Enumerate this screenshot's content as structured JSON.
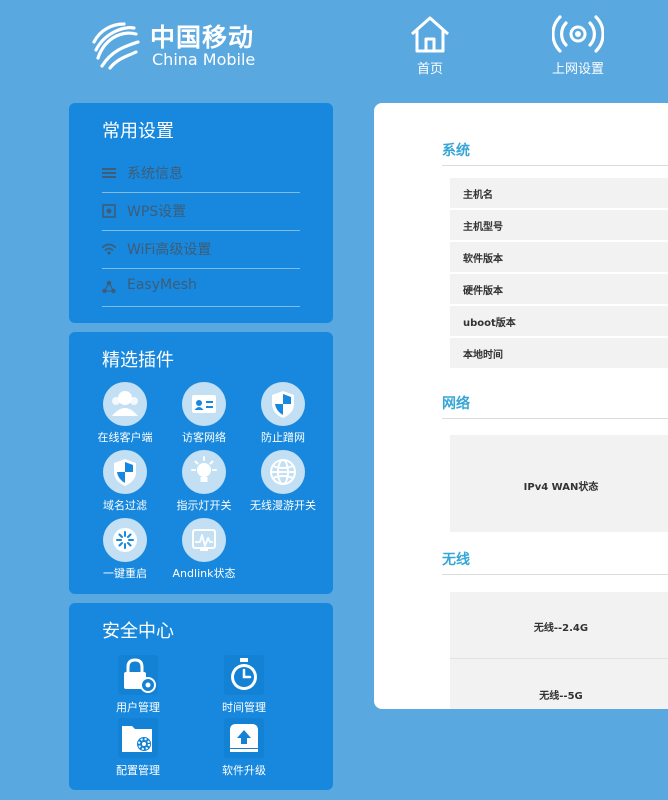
{
  "brand": {
    "name_cn": "中国移动",
    "name_en": "China Mobile"
  },
  "topnav": [
    {
      "label": "首页",
      "icon": "home-icon"
    },
    {
      "label": "上网设置",
      "icon": "wireless-signal-icon"
    }
  ],
  "common_settings": {
    "title": "常用设置",
    "items": [
      {
        "label": "系统信息",
        "icon": "list-icon"
      },
      {
        "label": "WPS设置",
        "icon": "wps-icon"
      },
      {
        "label": "WiFi高级设置",
        "icon": "wifi-icon"
      },
      {
        "label": "EasyMesh",
        "icon": "mesh-icon"
      }
    ]
  },
  "plugins": {
    "title": "精选插件",
    "items": [
      {
        "label": "在线客户端",
        "icon": "users-icon"
      },
      {
        "label": "访客网络",
        "icon": "guest-card-icon"
      },
      {
        "label": "防止蹭网",
        "icon": "shield-icon"
      },
      {
        "label": "域名过滤",
        "icon": "filter-shield-icon"
      },
      {
        "label": "指示灯开关",
        "icon": "bulb-icon"
      },
      {
        "label": "无线漫游开关",
        "icon": "globe-icon"
      },
      {
        "label": "一键重启",
        "icon": "restart-icon"
      },
      {
        "label": "Andlink状态",
        "icon": "monitor-icon"
      }
    ]
  },
  "security": {
    "title": "安全中心",
    "items": [
      {
        "label": "用户管理",
        "icon": "user-lock-icon"
      },
      {
        "label": "时间管理",
        "icon": "stopwatch-icon"
      },
      {
        "label": "配置管理",
        "icon": "folder-gear-icon"
      },
      {
        "label": "软件升级",
        "icon": "upload-icon"
      }
    ]
  },
  "main": {
    "system": {
      "title": "系统",
      "rows": [
        "主机名",
        "主机型号",
        "软件版本",
        "硬件版本",
        "uboot版本",
        "本地时间"
      ]
    },
    "network": {
      "title": "网络",
      "rows": [
        "IPv4 WAN状态"
      ]
    },
    "wireless": {
      "title": "无线",
      "rows": [
        "无线--2.4G",
        "无线--5G"
      ]
    }
  },
  "colors": {
    "background": "#5aa8e0",
    "panel": "#1788dd",
    "section_title": "#37a6d6"
  }
}
